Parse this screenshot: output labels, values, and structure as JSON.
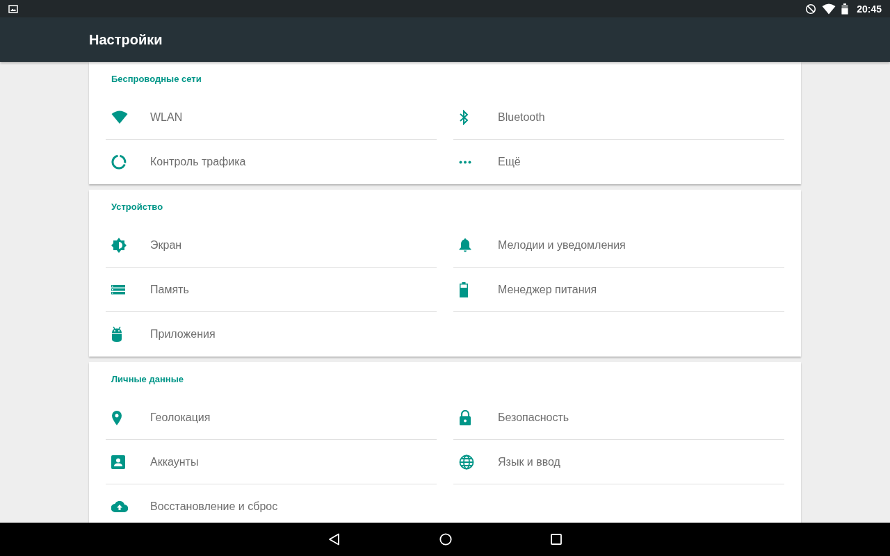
{
  "status_bar": {
    "time": "20:45"
  },
  "app_bar": {
    "title": "Настройки"
  },
  "sections": [
    {
      "title": "Беспроводные сети",
      "items": [
        {
          "label": "WLAN",
          "kind": "wifi"
        },
        {
          "label": "Bluetooth",
          "kind": "bluetooth"
        },
        {
          "label": "Контроль трафика",
          "kind": "data-usage"
        },
        {
          "label": "Ещё",
          "kind": "more"
        }
      ]
    },
    {
      "title": "Устройство",
      "items": [
        {
          "label": "Экран",
          "kind": "brightness"
        },
        {
          "label": "Мелодии и уведомления",
          "kind": "bell"
        },
        {
          "label": "Память",
          "kind": "storage"
        },
        {
          "label": "Менеджер питания",
          "kind": "battery"
        },
        {
          "label": "Приложения",
          "kind": "android"
        }
      ]
    },
    {
      "title": "Личные данные",
      "items": [
        {
          "label": "Геолокация",
          "kind": "location"
        },
        {
          "label": "Безопасность",
          "kind": "lock"
        },
        {
          "label": "Аккаунты",
          "kind": "account"
        },
        {
          "label": "Язык и ввод",
          "kind": "globe"
        },
        {
          "label": "Восстановление и сброс",
          "kind": "cloud-upload"
        }
      ]
    }
  ]
}
